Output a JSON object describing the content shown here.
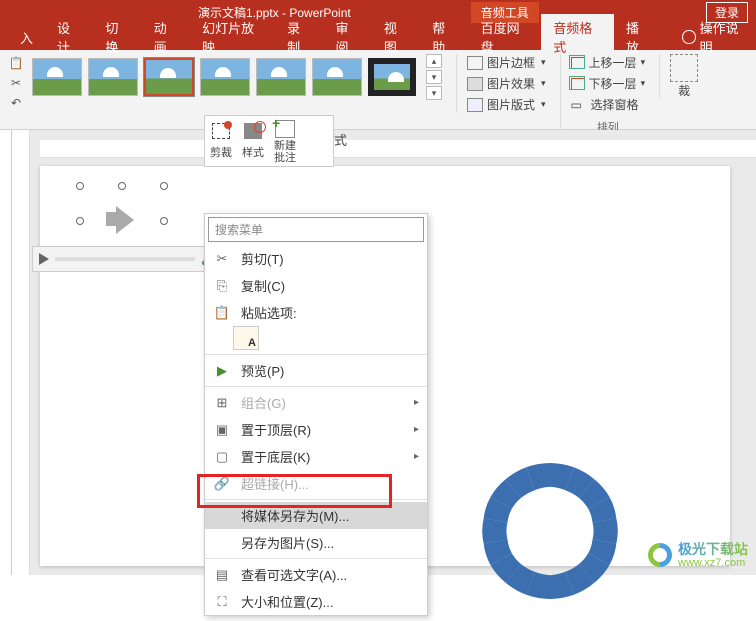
{
  "title": "演示文稿1.pptx - PowerPoint",
  "audio_tools": "音频工具",
  "login": "登录",
  "tabs": {
    "insert": "入",
    "design": "设计",
    "transition": "切换",
    "animation": "动画",
    "slideshow": "幻灯片放映",
    "record": "录制",
    "review": "审阅",
    "view": "视图",
    "help": "帮助",
    "baidu": "百度网盘",
    "audio_format": "音频格式",
    "playback": "播放"
  },
  "tip": "操作说明",
  "pic_styles": {
    "border": "图片边框",
    "effect": "图片效果",
    "layout": "图片版式"
  },
  "arrange": {
    "up": "上移一层",
    "down": "下移一层",
    "pane": "选择窗格",
    "label": "排列"
  },
  "crop": "裁",
  "mini": {
    "crop": "剪裁",
    "style": "样式",
    "newc": "新建\n批注"
  },
  "format_txt": "式",
  "search_placeholder": "搜索菜单",
  "menu": {
    "cut": "剪切(T)",
    "copy": "复制(C)",
    "paste": "粘贴选项:",
    "preview": "预览(P)",
    "group": "组合(G)",
    "front": "置于顶层(R)",
    "back": "置于底层(K)",
    "link": "超链接(H)...",
    "savemedia": "将媒体另存为(M)...",
    "savepic": "另存为图片(S)...",
    "alttext": "查看可选文字(A)...",
    "size": "大小和位置(Z)..."
  },
  "watermark": {
    "cn": "极光下载站",
    "url": "www.xz7.com"
  }
}
